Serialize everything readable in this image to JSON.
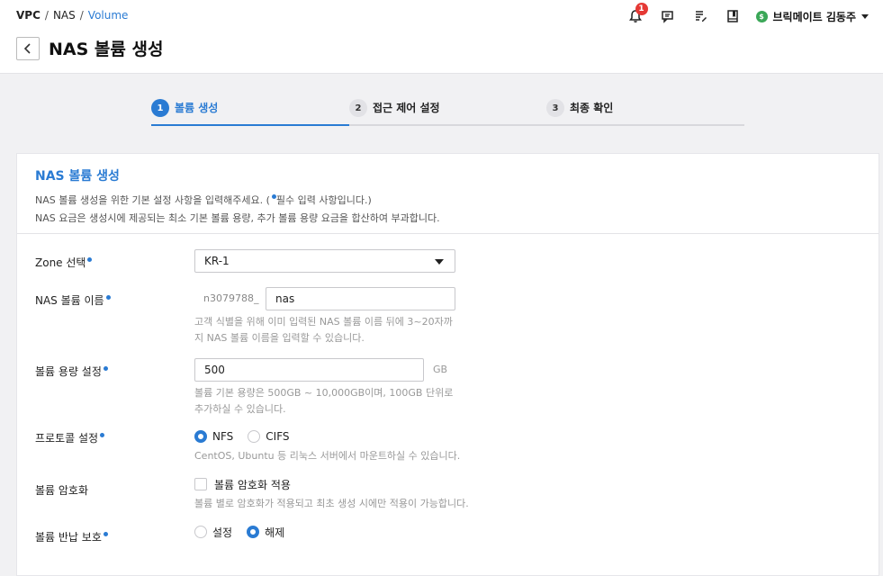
{
  "breadcrumb": [
    "VPC",
    "NAS",
    "Volume"
  ],
  "page_title": "NAS 볼륨 생성",
  "notifications": {
    "count": "1"
  },
  "user": {
    "badge": "$",
    "name": "브릭메이트 김동주"
  },
  "steps": [
    {
      "num": "1",
      "label": "볼륨 생성",
      "active": true
    },
    {
      "num": "2",
      "label": "접근 제어 설정",
      "active": false
    },
    {
      "num": "3",
      "label": "최종 확인",
      "active": false
    }
  ],
  "section": {
    "title": "NAS 볼륨 생성",
    "desc1_a": "NAS 볼륨 생성을 위한 기본 설정 사항을 입력해주세요. (",
    "desc1_b": "필수 입력 사항입니다.)",
    "desc2": "NAS 요금은 생성시에 제공되는 최소 기본 볼륨 용량, 추가 볼륨 용량 요금을 합산하여 부과합니다."
  },
  "form": {
    "zone": {
      "label": "Zone 선택",
      "value": "KR-1"
    },
    "name": {
      "label": "NAS 볼륨 이름",
      "prefix": "n3079788_",
      "value": "nas",
      "help1": "고객 식별을 위해 이미 입력된 NAS 볼륨 이름 뒤에 3~20자까",
      "help2": "지 NAS 볼륨 이름을 입력할 수 있습니다."
    },
    "capacity": {
      "label": "볼륨 용량 설정",
      "value": "500",
      "unit": "GB",
      "help1": "볼륨 기본 용량은 500GB ~ 10,000GB이며, 100GB 단위로",
      "help2": "추가하실 수 있습니다."
    },
    "protocol": {
      "label": "프로토콜 설정",
      "options": [
        "NFS",
        "CIFS"
      ],
      "selected": "NFS",
      "help": "CentOS, Ubuntu 등 리눅스 서버에서 마운트하실 수 있습니다."
    },
    "encryption": {
      "label": "볼륨 암호화",
      "checkbox_label": "볼륨 암호화 적용",
      "checked": false,
      "help": "볼륨 별로 암호화가 적용되고 최초 생성 시에만 적용이 가능합니다."
    },
    "return_protection": {
      "label": "볼륨 반납 보호",
      "options": [
        "설정",
        "해제"
      ],
      "selected": "해제"
    }
  },
  "colors": {
    "accent": "#2a7bd3",
    "badge": "#e53935",
    "user_dot": "#3aa757"
  }
}
